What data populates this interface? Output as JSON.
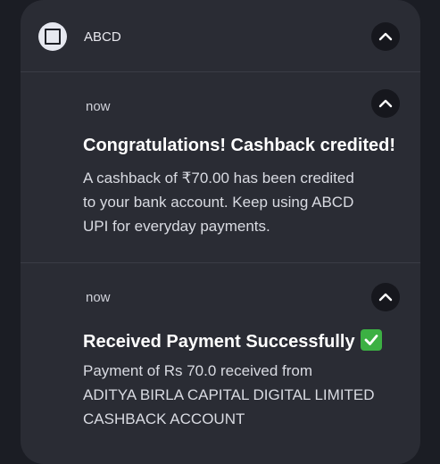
{
  "app": {
    "name": "ABCD"
  },
  "notifications": [
    {
      "time": "now",
      "title": "Congratulations! Cashback credited!",
      "body_lines": [
        "A cashback of ₹70.00 has been credited",
        "to your bank account. Keep using ABCD",
        "UPI for everyday payments."
      ]
    },
    {
      "time": "now",
      "title": "Received Payment Successfully",
      "title_emoji": "check-mark-button-icon",
      "body_lines": [
        "Payment of Rs 70.0 received from",
        "ADITYA BIRLA CAPITAL DIGITAL LIMITED",
        "CASHBACK ACCOUNT"
      ]
    }
  ],
  "colors": {
    "background": "#1b1d24",
    "panel": "#2a2c34",
    "divider": "#3a3c45",
    "button": "#16171d",
    "title_text": "#ffffff",
    "body_text": "#d9dbe2",
    "check_emoji": "#3cb043"
  }
}
